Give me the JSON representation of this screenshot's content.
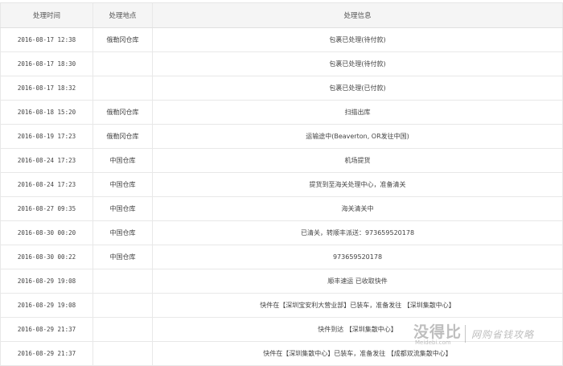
{
  "table": {
    "headers": [
      "处理时间",
      "处理地点",
      "处理信息"
    ],
    "rows": [
      {
        "time": "2016-08-17 12:38",
        "location": "俄勒冈仓库",
        "info": "包裹已处理(待付款)"
      },
      {
        "time": "2016-08-17 18:30",
        "location": "",
        "info": "包裹已处理(待付款)"
      },
      {
        "time": "2016-08-17 18:32",
        "location": "",
        "info": "包裹已处理(已付款)"
      },
      {
        "time": "2016-08-18 15:20",
        "location": "俄勒冈仓库",
        "info": "扫描出库"
      },
      {
        "time": "2016-08-19 17:23",
        "location": "俄勒冈仓库",
        "info": "运输途中(Beaverton, OR发往中国)"
      },
      {
        "time": "2016-08-24 17:23",
        "location": "中国仓库",
        "info": "机场提货"
      },
      {
        "time": "2016-08-24 17:23",
        "location": "中国仓库",
        "info": "提货到至海关处理中心，准备清关"
      },
      {
        "time": "2016-08-27 09:35",
        "location": "中国仓库",
        "info": "海关清关中"
      },
      {
        "time": "2016-08-30 00:20",
        "location": "中国仓库",
        "info": "已清关，转顺丰派送：973659520178"
      },
      {
        "time": "2016-08-30 00:22",
        "location": "中国仓库",
        "info": "973659520178"
      },
      {
        "time": "2016-08-29 19:08",
        "location": "",
        "info": "顺丰速运 已收取快件"
      },
      {
        "time": "2016-08-29 19:08",
        "location": "",
        "info": "快件在【深圳宝安利大营业部】已装车，准备发往 【深圳集散中心】"
      },
      {
        "time": "2016-08-29 21:37",
        "location": "",
        "info": "快件到达 【深圳集散中心】"
      },
      {
        "time": "2016-08-29 21:37",
        "location": "",
        "info": "快件在【深圳集散中心】已装车，准备发往 【成都双流集散中心】"
      }
    ]
  },
  "watermark": {
    "brand": "没得比",
    "domain": "Meidebi.com",
    "slogan": "网购省钱攻略"
  }
}
